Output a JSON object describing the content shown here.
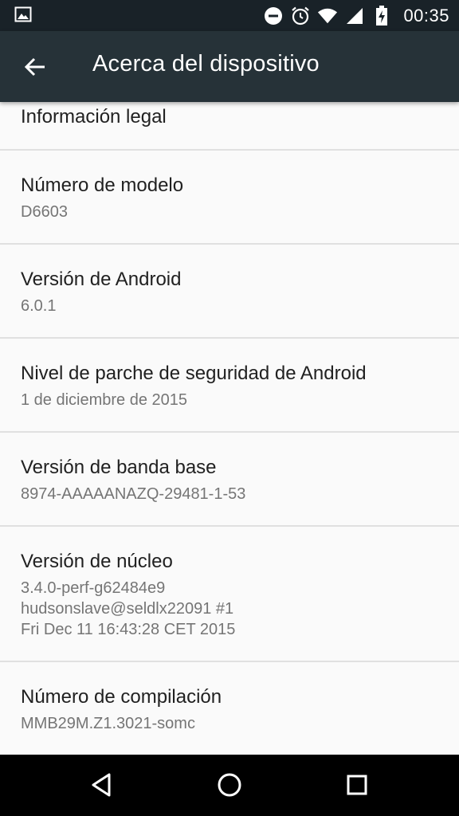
{
  "status_bar": {
    "time": "00:35",
    "icons": [
      "gallery-icon",
      "do-not-disturb-icon",
      "alarm-icon",
      "wifi-icon",
      "signal-icon",
      "battery-charging-icon"
    ]
  },
  "toolbar": {
    "title": "Acerca del dispositivo",
    "back_icon": "arrow-back-icon"
  },
  "items": [
    {
      "title": "Información legal",
      "summary": ""
    },
    {
      "title": "Número de modelo",
      "summary": "D6603"
    },
    {
      "title": "Versión de Android",
      "summary": "6.0.1"
    },
    {
      "title": "Nivel de parche de seguridad de Android",
      "summary": "1 de diciembre de 2015"
    },
    {
      "title": "Versión de banda base",
      "summary": "8974-AAAAANAZQ-29481-1-53"
    },
    {
      "title": "Versión de núcleo",
      "summary": "3.4.0-perf-g62484e9\nhudsonslave@seldlx22091 #1\nFri Dec 11 16:43:28 CET 2015"
    },
    {
      "title": "Número de compilación",
      "summary": "MMB29M.Z1.3021-somc"
    }
  ],
  "nav_bar": {
    "icons": [
      "back-triangle-icon",
      "home-circle-icon",
      "recents-square-icon"
    ]
  },
  "colors": {
    "status_bar": "#192228",
    "toolbar": "#263238",
    "background": "#fafafa",
    "title_text": "#212121",
    "summary_text": "#757575",
    "divider": "#e0e0e0"
  }
}
